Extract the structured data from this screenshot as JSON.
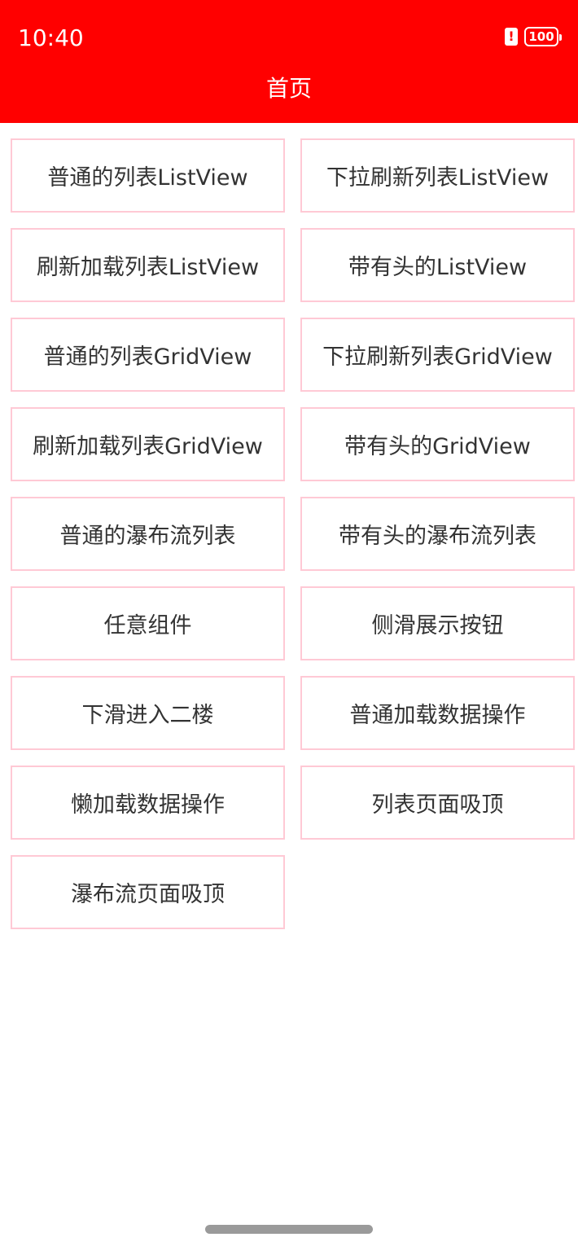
{
  "status_bar": {
    "time": "10:40",
    "alert_glyph": "!",
    "battery_level": "100",
    "icons": [
      "alert-icon",
      "battery-icon"
    ]
  },
  "header": {
    "title": "首页",
    "background_color": "#ff0000"
  },
  "menu": {
    "items": [
      {
        "label": "普通的列表ListView"
      },
      {
        "label": "下拉刷新列表ListView"
      },
      {
        "label": "刷新加载列表ListView"
      },
      {
        "label": "带有头的ListView"
      },
      {
        "label": "普通的列表GridView"
      },
      {
        "label": "下拉刷新列表GridView"
      },
      {
        "label": "刷新加载列表GridView"
      },
      {
        "label": "带有头的GridView"
      },
      {
        "label": "普通的瀑布流列表"
      },
      {
        "label": "带有头的瀑布流列表"
      },
      {
        "label": "任意组件"
      },
      {
        "label": "侧滑展示按钮"
      },
      {
        "label": "下滑进入二楼"
      },
      {
        "label": "普通加载数据操作"
      },
      {
        "label": "懒加载数据操作"
      },
      {
        "label": "列表页面吸顶"
      },
      {
        "label": "瀑布流页面吸顶"
      }
    ],
    "border_color": "#ffc9d5"
  }
}
